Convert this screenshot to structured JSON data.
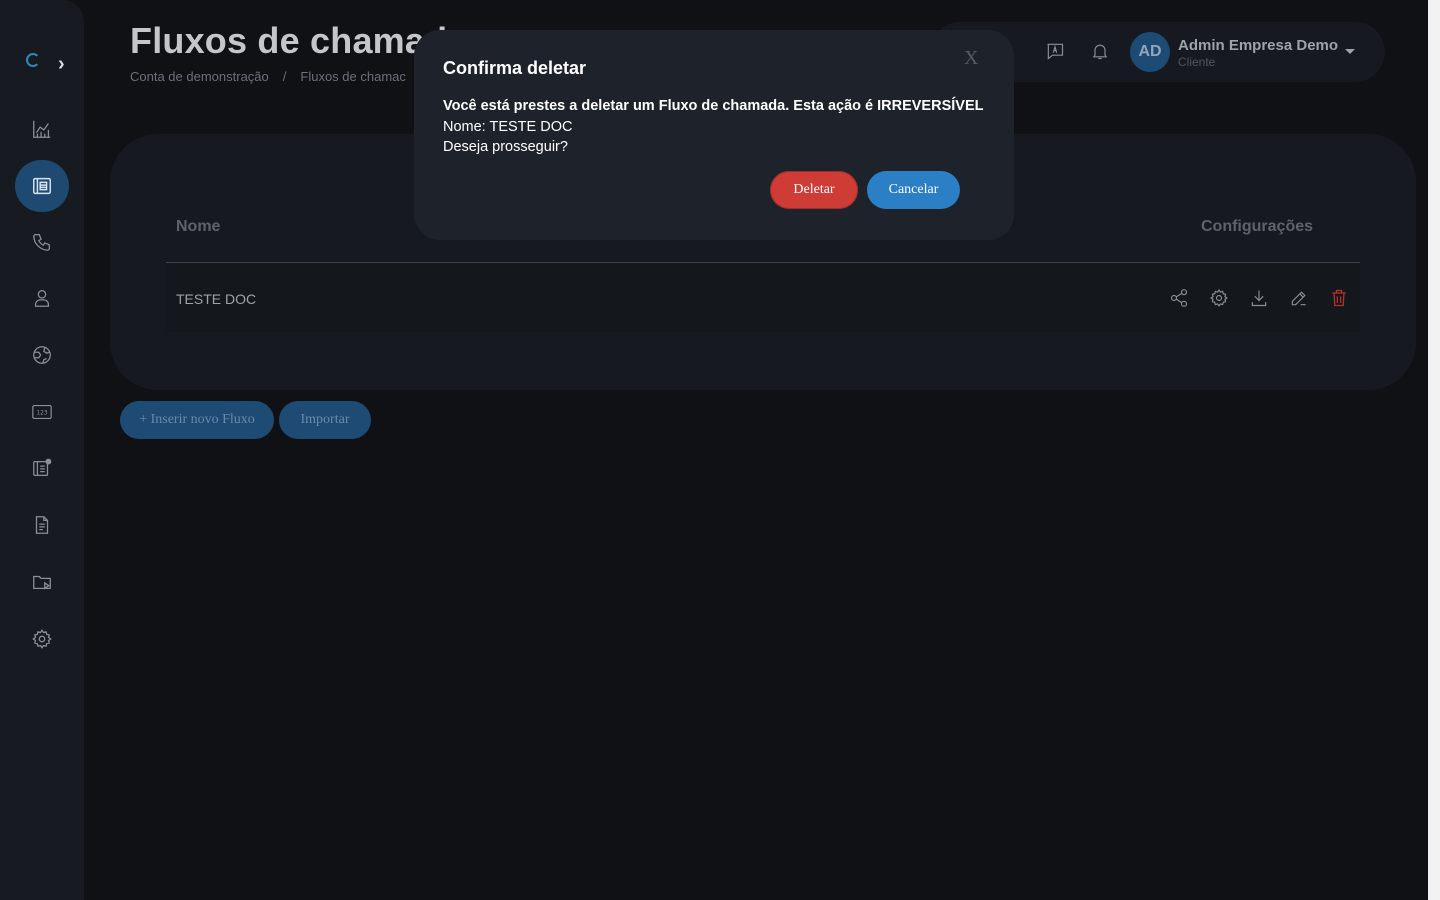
{
  "header": {
    "title": "Fluxos de chamad",
    "breadcrumb": [
      "Conta de demonstração",
      "/",
      "Fluxos de chamac"
    ],
    "user": {
      "initials": "AD",
      "name": "Admin Empresa Demo",
      "role": "Cliente"
    }
  },
  "sidebar": {
    "items": [
      {
        "icon": "chart-icon"
      },
      {
        "icon": "flows-icon",
        "active": true
      },
      {
        "icon": "phone-icon"
      },
      {
        "icon": "user-icon"
      },
      {
        "icon": "globe-icon"
      },
      {
        "icon": "numbers-icon"
      },
      {
        "icon": "queue-icon"
      },
      {
        "icon": "document-icon"
      },
      {
        "icon": "media-folder-icon"
      },
      {
        "icon": "gear-icon"
      }
    ]
  },
  "table": {
    "columns": [
      "Nome",
      "Configurações"
    ],
    "rows": [
      {
        "name": "TESTE DOC"
      }
    ]
  },
  "actions": {
    "insert_label": "+ Inserir novo Fluxo",
    "import_label": "Importar"
  },
  "modal": {
    "title": "Confirma deletar",
    "close_label": "X",
    "warning": "Você está prestes a deletar um Fluxo de chamada. Esta ação é IRREVERSÍVEL",
    "name_line": "Nome: TESTE DOC",
    "question": "Deseja prosseguir?",
    "delete_label": "Deletar",
    "cancel_label": "Cancelar"
  },
  "colors": {
    "accent": "#2b7fc4",
    "danger": "#cf3b35",
    "background": "#0f1115"
  }
}
